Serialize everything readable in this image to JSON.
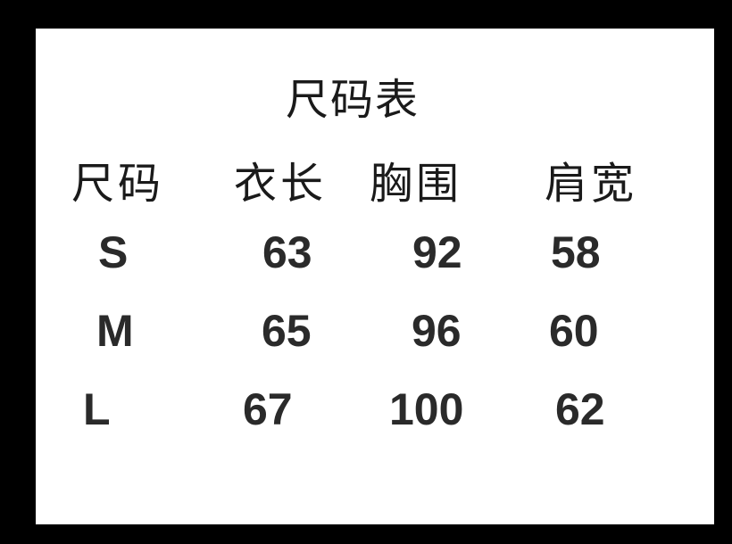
{
  "title": "尺码表",
  "columns": [
    "尺码",
    "衣长",
    "胸围",
    "肩宽"
  ],
  "rows": [
    {
      "size": "S",
      "length": "63",
      "chest": "92",
      "shoulder": "58"
    },
    {
      "size": "M",
      "length": "65",
      "chest": "96",
      "shoulder": "60"
    },
    {
      "size": "L",
      "length": "67",
      "chest": "100",
      "shoulder": "62"
    }
  ],
  "colors": {
    "frame": "#000000",
    "background": "#ffffff",
    "text": "#1a1a1a"
  }
}
